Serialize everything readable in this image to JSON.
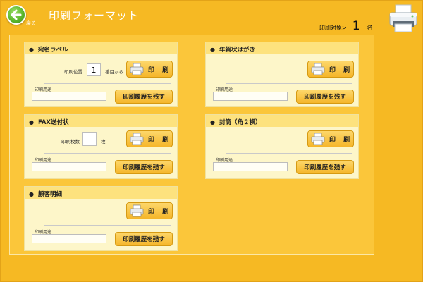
{
  "header": {
    "back_label": "戻る",
    "title": "印刷フォーマット",
    "target_label": "印刷対象>",
    "target_count": "1",
    "target_unit": "名"
  },
  "cards": {
    "address_label": {
      "title": "宛名ラベル",
      "position_label": "印刷位置",
      "position_value": "1",
      "position_suffix": "番目から",
      "print_label": "印 刷",
      "usage_label": "印刷用途",
      "history_label": "印刷履歴を残す"
    },
    "new_year_card": {
      "title": "年賀状はがき",
      "print_label": "印 刷",
      "usage_label": "印刷用途",
      "history_label": "印刷履歴を残す"
    },
    "fax": {
      "title": "FAX送付状",
      "copies_label": "印刷枚数",
      "copies_suffix": "枚",
      "print_label": "印 刷",
      "usage_label": "印刷用途",
      "history_label": "印刷履歴を残す"
    },
    "envelope": {
      "title": "封筒（角２横）",
      "print_label": "印 刷",
      "usage_label": "印刷用途",
      "history_label": "印刷履歴を残す"
    },
    "customer_detail": {
      "title": "顧客明細",
      "print_label": "印 刷",
      "usage_label": "印刷用途",
      "history_label": "印刷履歴を残す"
    }
  },
  "colors": {
    "background": "#f6b923",
    "card": "#fdf6c9",
    "card_header": "#fde27e",
    "button": "#f5b62a",
    "back_button": "#5cb82e"
  },
  "icons": {
    "back": "back-arrow-icon",
    "printer": "printer-icon"
  }
}
